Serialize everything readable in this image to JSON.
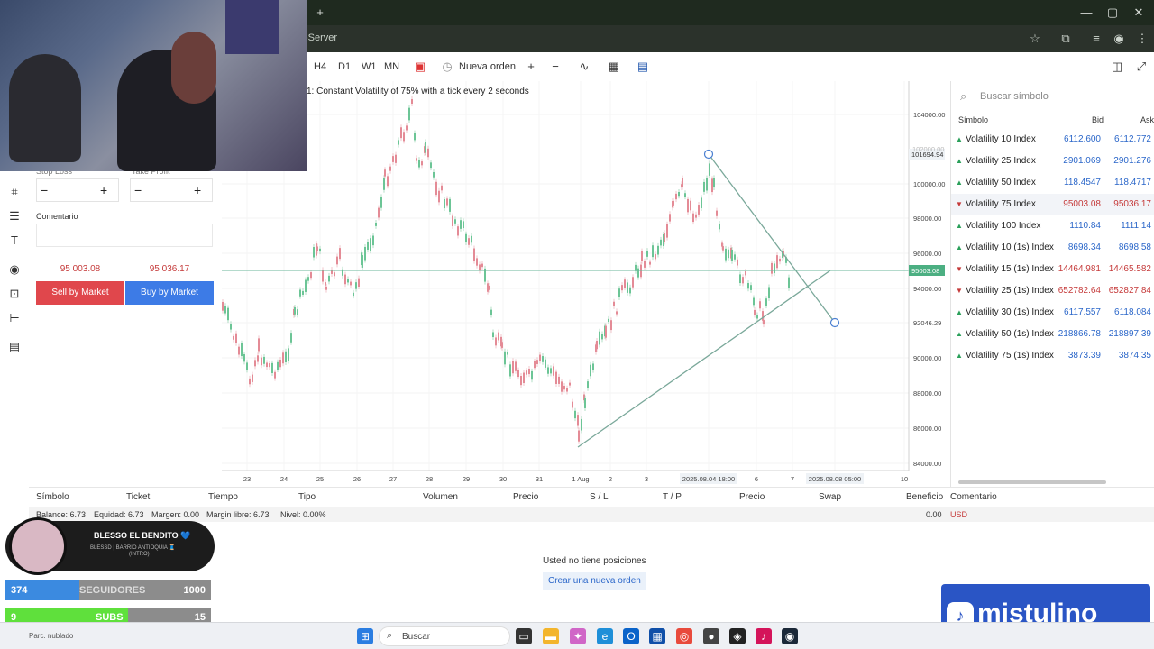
{
  "browser": {
    "new_tab_glyph": "+",
    "address_fragment": "-Server",
    "window_controls": [
      "—",
      "▢",
      "✕"
    ]
  },
  "toolbar": {
    "timeframes": [
      "H4",
      "D1",
      "W1",
      "MN"
    ],
    "new_order_label": "Nueva orden",
    "zoom_in": "+",
    "zoom_out": "−"
  },
  "chart": {
    "description": "1: Constant Volatility of 75% with a tick every 2 seconds",
    "price_labels": [
      "104000.00",
      "100000.00",
      "98000.00",
      "96000.00",
      "94000.00",
      "92046.29",
      "90000.00",
      "88000.00",
      "86000.00",
      "84000.00"
    ],
    "current_price_tag": "95003.08",
    "top_price_tag": "101694.94",
    "partial_price_label": "102000.00",
    "date_labels": [
      "23",
      "24",
      "25",
      "26",
      "27",
      "28",
      "29",
      "30",
      "31",
      "1 Aug",
      "2",
      "3",
      "2025.08.04 18:00",
      "6",
      "7",
      "2025.08.08 05:00",
      "10"
    ]
  },
  "order_panel": {
    "stop_loss_label": "Stop Loss",
    "take_profit_label": "Take Profit",
    "minus": "−",
    "plus": "+",
    "comment_label": "Comentario",
    "sell_price": "95 003.08",
    "buy_price": "95 036.17",
    "sell_label": "Sell by Market",
    "buy_label": "Buy by Market",
    "sell_color": "#e0474c",
    "buy_color": "#3d7be6"
  },
  "watchlist": {
    "search_placeholder": "Buscar símbolo",
    "headers": {
      "symbol": "Símbolo",
      "bid": "Bid",
      "ask": "Ask"
    },
    "rows": [
      {
        "name": "Volatility 10 Index",
        "bid": "6112.600",
        "ask": "6112.772",
        "dir": "up"
      },
      {
        "name": "Volatility 25 Index",
        "bid": "2901.069",
        "ask": "2901.276",
        "dir": "up"
      },
      {
        "name": "Volatility 50 Index",
        "bid": "118.4547",
        "ask": "118.4717",
        "dir": "up"
      },
      {
        "name": "Volatility 75 Index",
        "bid": "95003.08",
        "ask": "95036.17",
        "dir": "down"
      },
      {
        "name": "Volatility 100 Index",
        "bid": "1110.84",
        "ask": "1111.14",
        "dir": "up"
      },
      {
        "name": "Volatility 10 (1s) Index",
        "bid": "8698.34",
        "ask": "8698.58",
        "dir": "up"
      },
      {
        "name": "Volatility 15 (1s) Index",
        "bid": "14464.981",
        "ask": "14465.582",
        "dir": "down"
      },
      {
        "name": "Volatility 25 (1s) Index",
        "bid": "652782.64",
        "ask": "652827.84",
        "dir": "down"
      },
      {
        "name": "Volatility 30 (1s) Index",
        "bid": "6117.557",
        "ask": "6118.084",
        "dir": "up"
      },
      {
        "name": "Volatility 50 (1s) Index",
        "bid": "218866.78",
        "ask": "218897.39",
        "dir": "up"
      },
      {
        "name": "Volatility 75 (1s) Index",
        "bid": "3873.39",
        "ask": "3874.35",
        "dir": "up"
      }
    ]
  },
  "positions": {
    "headers": [
      "Símbolo",
      "Ticket",
      "Tiempo",
      "Tipo",
      "Volumen",
      "Precio",
      "S / L",
      "T / P",
      "Precio",
      "Swap",
      "Beneficio",
      "Comentario"
    ],
    "balance": "Balance: 6.73",
    "equity": "Equidad: 6.73",
    "margin": "Margen: 0.00",
    "free_margin": "Margin libre: 6.73",
    "level": "Nivel: 0.00%",
    "profit_total": "0.00",
    "currency": "USD",
    "empty_message": "Usted no tiene posiciones",
    "create_order_label": "Crear una nueva orden"
  },
  "stream": {
    "name": "BLESSO EL BENDITO 💙",
    "subtitle_line1": "BLESSD | BARRIO ANTIOQUIA 🧵",
    "subtitle_line2": "(INTRO)",
    "followers_count": "374",
    "followers_label": "SEGUIDORES",
    "followers_goal": "1000",
    "subs_count": "9",
    "subs_label": "SUBS",
    "subs_goal": "15",
    "brand": "mistulino"
  },
  "taskbar": {
    "search_placeholder": "Buscar",
    "weather": "Parc. nublado"
  }
}
